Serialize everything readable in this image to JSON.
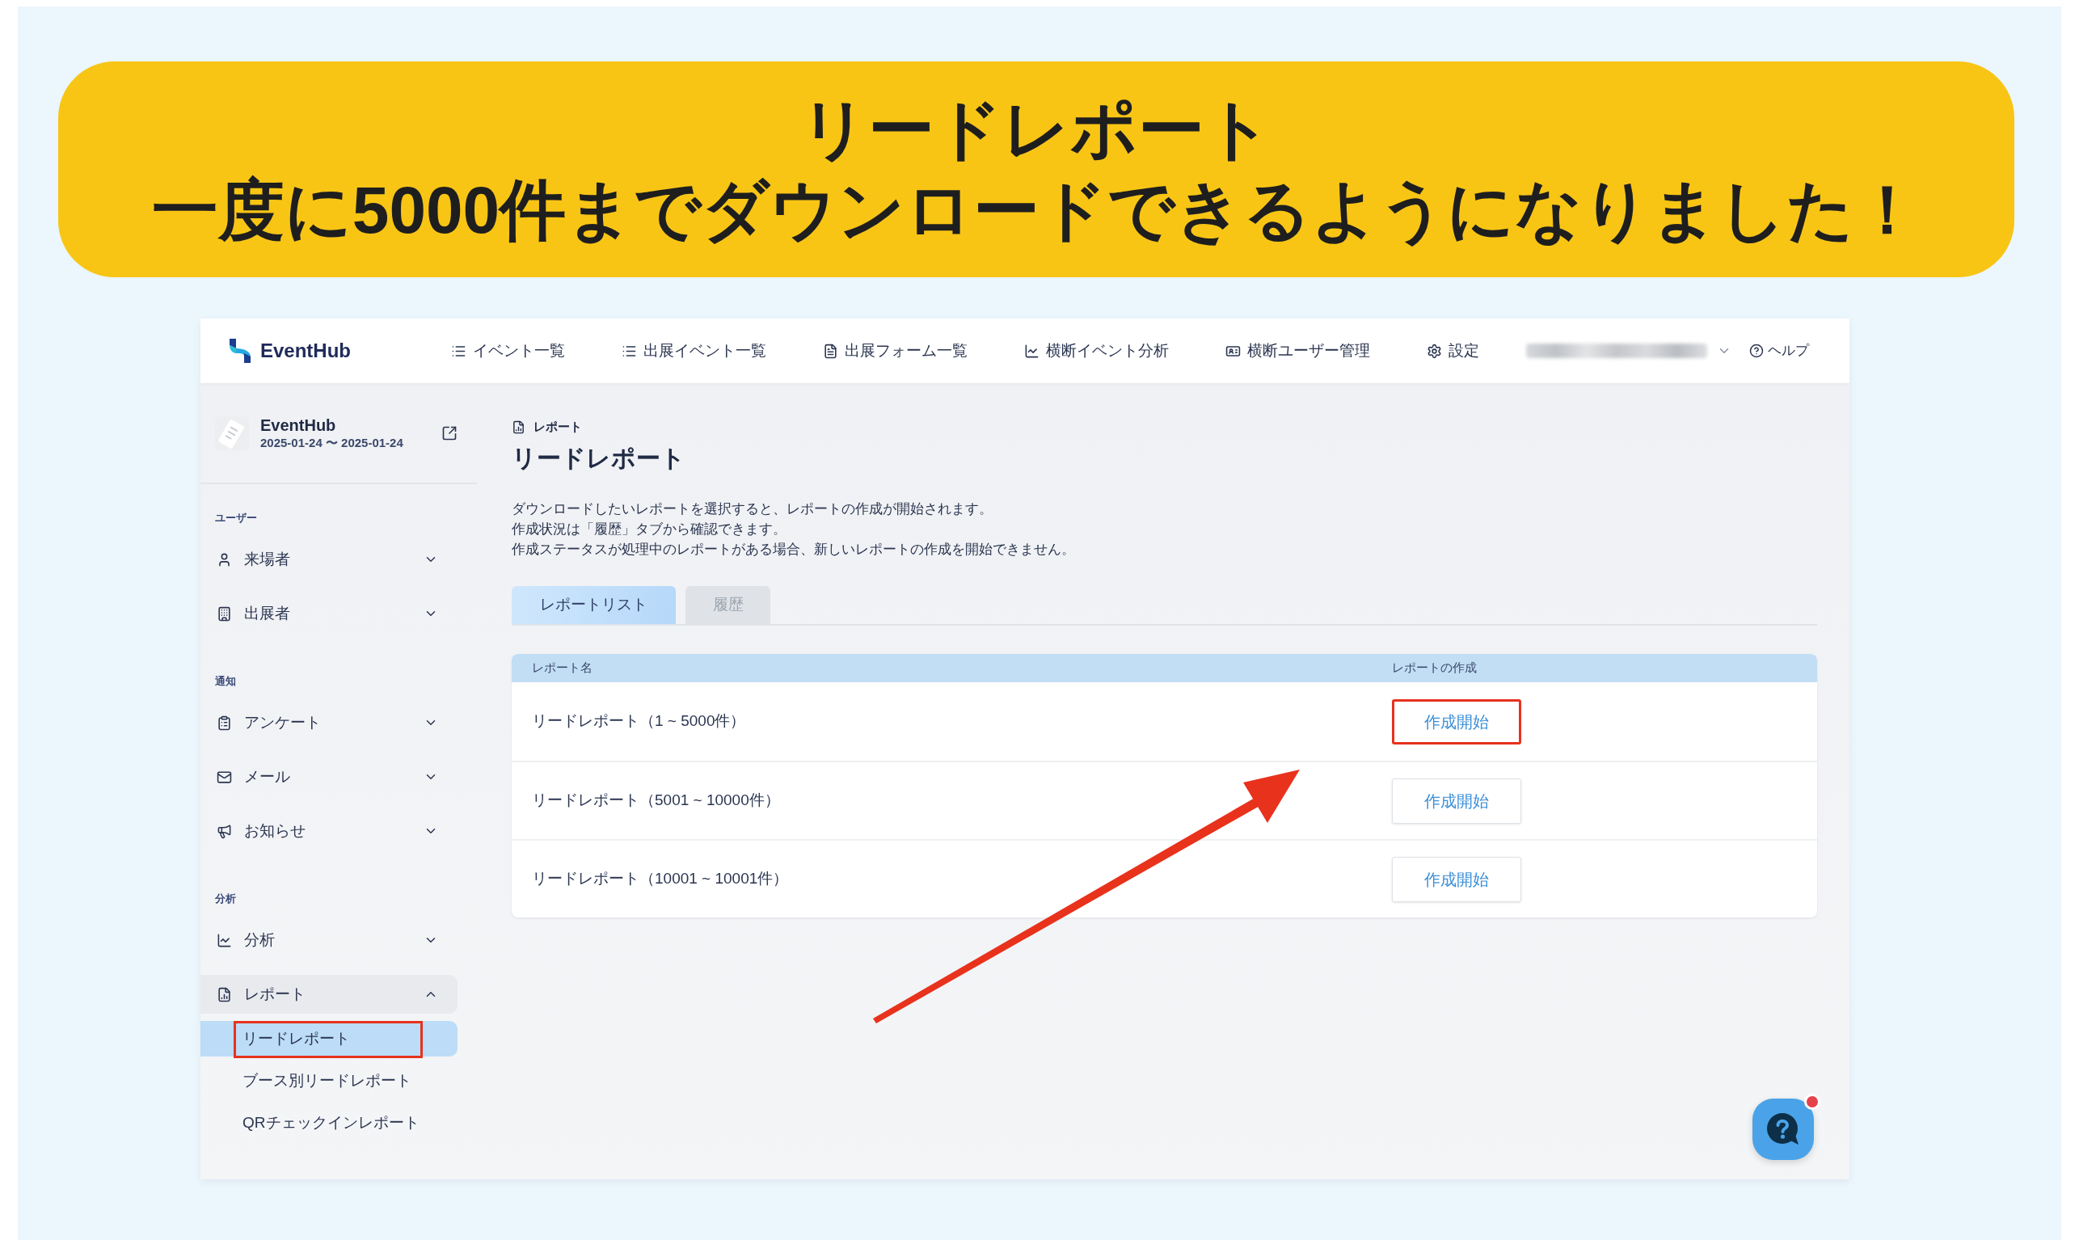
{
  "banner": {
    "title": "リードレポート",
    "subtitle": "一度に5000件までダウンロードできるようになりました！"
  },
  "header": {
    "logo_text": "EventHub",
    "nav": [
      {
        "label": "イベント一覧"
      },
      {
        "label": "出展イベント一覧"
      },
      {
        "label": "出展フォーム一覧"
      },
      {
        "label": "横断イベント分析"
      },
      {
        "label": "横断ユーザー管理"
      },
      {
        "label": "設定"
      }
    ],
    "help": "ヘルプ"
  },
  "sidebar": {
    "event": {
      "name": "EventHub",
      "dates": "2025-01-24 〜 2025-01-24"
    },
    "sections": [
      {
        "heading": "ユーザー",
        "items": [
          {
            "label": "来場者",
            "expanded": false
          },
          {
            "label": "出展者",
            "expanded": false
          }
        ]
      },
      {
        "heading": "通知",
        "items": [
          {
            "label": "アンケート",
            "expanded": false
          },
          {
            "label": "メール",
            "expanded": false
          },
          {
            "label": "お知らせ",
            "expanded": false
          }
        ]
      },
      {
        "heading": "分析",
        "items": [
          {
            "label": "分析",
            "expanded": false
          },
          {
            "label": "レポート",
            "expanded": true,
            "children": [
              {
                "label": "リードレポート",
                "selected": true,
                "highlighted": true
              },
              {
                "label": "ブース別リードレポート",
                "selected": false,
                "highlighted": false
              },
              {
                "label": "QRチェックインレポート",
                "selected": false,
                "highlighted": false
              }
            ]
          }
        ]
      }
    ]
  },
  "main": {
    "breadcrumb": "レポート",
    "title": "リードレポート",
    "description": [
      "ダウンロードしたいレポートを選択すると、レポートの作成が開始されます。",
      "作成状況は「履歴」タブから確認できます。",
      "作成ステータスが処理中のレポートがある場合、新しいレポートの作成を開始できません。"
    ],
    "tabs": [
      {
        "label": "レポートリスト",
        "selected": true
      },
      {
        "label": "履歴",
        "selected": false
      }
    ],
    "table": {
      "columns": [
        "レポート名",
        "レポートの作成"
      ],
      "rows": [
        {
          "name": "リードレポート（1 ~ 5000件）",
          "action": "作成開始",
          "highlighted": true
        },
        {
          "name": "リードレポート（5001 ~ 10000件）",
          "action": "作成開始",
          "highlighted": false
        },
        {
          "name": "リードレポート（10001 ~ 10001件）",
          "action": "作成開始",
          "highlighted": false
        }
      ]
    }
  }
}
